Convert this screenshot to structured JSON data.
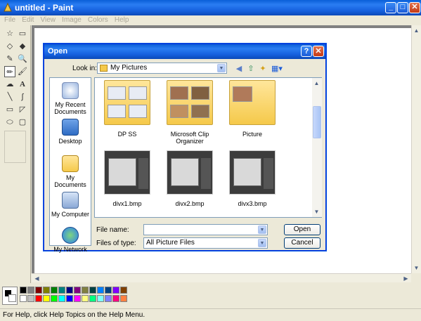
{
  "window": {
    "title": "untitled - Paint",
    "min_icon": "minimize-icon",
    "max_icon": "maximize-icon",
    "close_icon": "close-icon"
  },
  "menu": [
    "File",
    "Edit",
    "View",
    "Image",
    "Colors",
    "Help"
  ],
  "tools": [
    "free-form-select",
    "rect-select",
    "eraser",
    "fill",
    "pick-color",
    "magnifier",
    "pencil",
    "brush",
    "airbrush",
    "text",
    "line",
    "curve",
    "rectangle",
    "polygon",
    "ellipse",
    "rounded-rect"
  ],
  "tool_glyphs": [
    "☆",
    "▭",
    "◇",
    "◆",
    "✎",
    "🔍",
    "✏",
    "🖌",
    "☁",
    "A",
    "╲",
    "∫",
    "▭",
    "◸",
    "⬭",
    "▢"
  ],
  "palette": {
    "row1": [
      "#000000",
      "#808080",
      "#800000",
      "#808000",
      "#008000",
      "#008080",
      "#000080",
      "#800080",
      "#808040",
      "#004040",
      "#0080ff",
      "#004080",
      "#8000ff",
      "#804000"
    ],
    "row2": [
      "#ffffff",
      "#c0c0c0",
      "#ff0000",
      "#ffff00",
      "#00ff00",
      "#00ffff",
      "#0000ff",
      "#ff00ff",
      "#ffff80",
      "#00ff80",
      "#80ffff",
      "#8080ff",
      "#ff0080",
      "#ff8040"
    ]
  },
  "status": "For Help, click Help Topics on the Help Menu.",
  "dialog": {
    "title": "Open",
    "look_in_label": "Look in:",
    "look_in_value": "My Pictures",
    "places": [
      "My Recent Documents",
      "Desktop",
      "My Documents",
      "My Computer",
      "My Network"
    ],
    "items": [
      {
        "name": "DP SS",
        "kind": "folder"
      },
      {
        "name": "Microsoft Clip Organizer",
        "kind": "folder"
      },
      {
        "name": "Picture",
        "kind": "folder"
      },
      {
        "name": "divx1.bmp",
        "kind": "image"
      },
      {
        "name": "divx2.bmp",
        "kind": "image"
      },
      {
        "name": "divx3.bmp",
        "kind": "image"
      }
    ],
    "file_name_label": "File name:",
    "file_name_value": "",
    "files_of_type_label": "Files of type:",
    "files_of_type_value": "All Picture Files",
    "open_button": "Open",
    "cancel_button": "Cancel",
    "help_button": "?",
    "close_button": "✕"
  }
}
